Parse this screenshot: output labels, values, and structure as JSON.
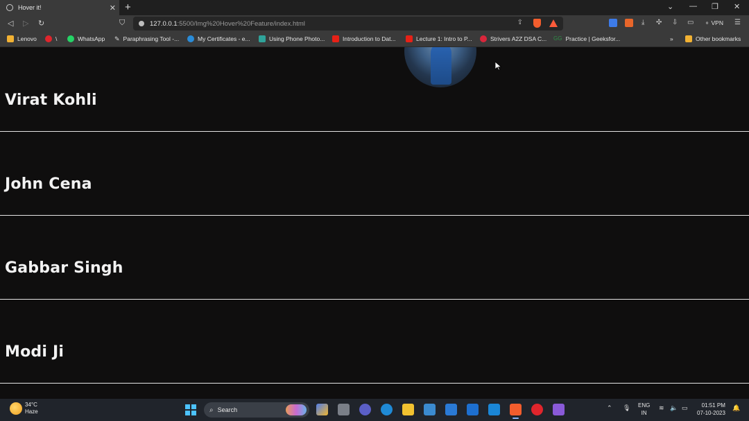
{
  "browser": {
    "tab_title": "Hover it!",
    "url_host": "127.0.0.1",
    "url_rest": ":5500/Img%20Hover%20Feature/index.html",
    "vpn_label": "VPN"
  },
  "bookmarks": [
    {
      "label": "Lenovo",
      "icon": "folder-icon",
      "color": "#f2b233"
    },
    {
      "label": "\\",
      "icon": "opera-icon",
      "color": "#e0252c"
    },
    {
      "label": "WhatsApp",
      "icon": "whatsapp-icon",
      "color": "#25d366"
    },
    {
      "label": "Paraphrasing Tool -...",
      "icon": "quill-icon",
      "color": "#dddddd"
    },
    {
      "label": "My Certificates - e...",
      "icon": "edge-icon",
      "color": "#2a8cd8"
    },
    {
      "label": "Using Phone Photo...",
      "icon": "docs-icon",
      "color": "#2fa39a"
    },
    {
      "label": "Introduction to Dat...",
      "icon": "youtube-icon",
      "color": "#e62117"
    },
    {
      "label": "Lecture 1: Intro to P...",
      "icon": "youtube-icon",
      "color": "#e62117"
    },
    {
      "label": "Strivers A2Z DSA C...",
      "icon": "tuf-icon",
      "color": "#d9263b"
    },
    {
      "label": "Practice | Geeksfor...",
      "icon": "gfg-icon",
      "color": "#2f8d46"
    },
    {
      "label": "Other bookmarks",
      "icon": "folder-icon",
      "color": "#f2b233"
    }
  ],
  "page": {
    "names": [
      "Virat Kohli",
      "John Cena",
      "Gabbar Singh",
      "Modi Ji"
    ]
  },
  "taskbar": {
    "temperature": "34°C",
    "weather": "Haze",
    "search_label": "Search",
    "lang_line1": "ENG",
    "lang_line2": "IN",
    "time": "01:51 PM",
    "date": "07-10-2023"
  },
  "colors": {
    "background": "#0f0e0e",
    "divider": "#e6e6e6",
    "text": "#f2f2f2",
    "accent": "#4cc2ff"
  }
}
